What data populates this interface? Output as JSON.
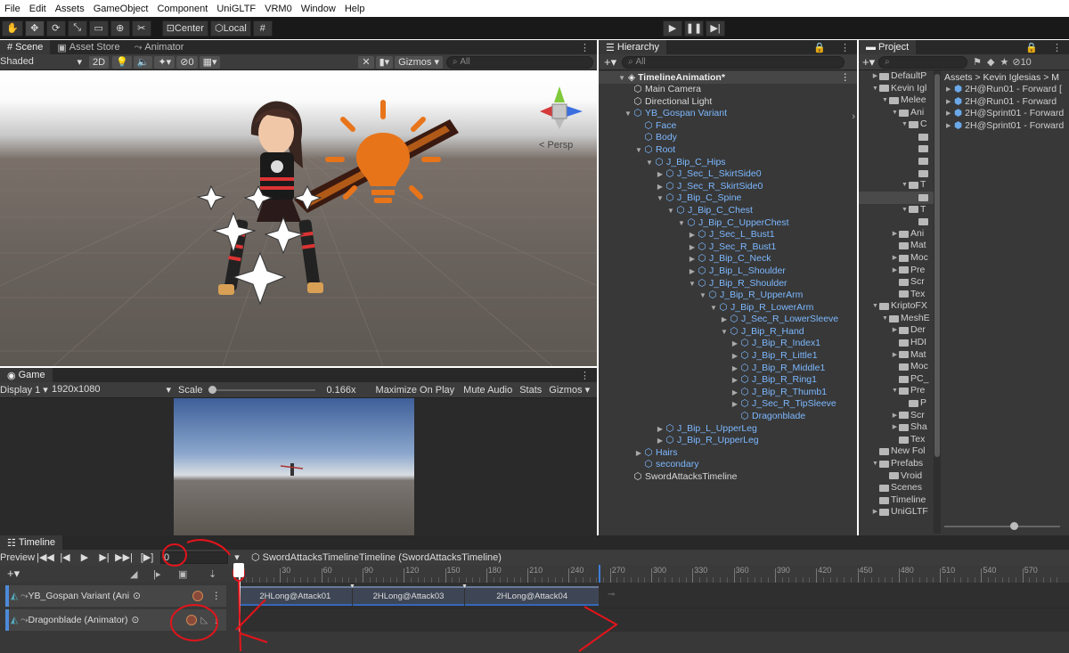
{
  "menu": [
    "File",
    "Edit",
    "Assets",
    "GameObject",
    "Component",
    "UniGLTF",
    "VRM0",
    "Window",
    "Help"
  ],
  "toolbar": {
    "center": "Center",
    "local": "Local"
  },
  "scene": {
    "tabs": [
      "Scene",
      "Asset Store",
      "Animator"
    ],
    "shading": "Shaded",
    "mode2d": "2D",
    "gizmo_count": "0",
    "gizmos": "Gizmos",
    "search_placeholder": "All",
    "persp": "Persp"
  },
  "game": {
    "tab": "Game",
    "display": "Display 1",
    "resolution": "1920x1080",
    "scale_label": "Scale",
    "scale_value": "0.166x",
    "buttons": [
      "Maximize On Play",
      "Mute Audio",
      "Stats",
      "Gizmos"
    ]
  },
  "hierarchy": {
    "tab": "Hierarchy",
    "search_placeholder": "All",
    "scene_name": "TimelineAnimation*",
    "rows": [
      {
        "t": "Main Camera",
        "d": 1,
        "c": "white",
        "a": ""
      },
      {
        "t": "Directional Light",
        "d": 1,
        "c": "white",
        "a": ""
      },
      {
        "t": "YB_Gospan Variant",
        "d": 1,
        "c": "blue",
        "a": "▼"
      },
      {
        "t": "Face",
        "d": 2,
        "c": "blue",
        "a": ""
      },
      {
        "t": "Body",
        "d": 2,
        "c": "blue",
        "a": ""
      },
      {
        "t": "Root",
        "d": 2,
        "c": "blue",
        "a": "▼"
      },
      {
        "t": "J_Bip_C_Hips",
        "d": 3,
        "c": "blue",
        "a": "▼"
      },
      {
        "t": "J_Sec_L_SkirtSide0",
        "d": 4,
        "c": "blue",
        "a": "▶"
      },
      {
        "t": "J_Sec_R_SkirtSide0",
        "d": 4,
        "c": "blue",
        "a": "▶"
      },
      {
        "t": "J_Bip_C_Spine",
        "d": 4,
        "c": "blue",
        "a": "▼"
      },
      {
        "t": "J_Bip_C_Chest",
        "d": 5,
        "c": "blue",
        "a": "▼"
      },
      {
        "t": "J_Bip_C_UpperChest",
        "d": 6,
        "c": "blue",
        "a": "▼"
      },
      {
        "t": "J_Sec_L_Bust1",
        "d": 7,
        "c": "blue",
        "a": "▶"
      },
      {
        "t": "J_Sec_R_Bust1",
        "d": 7,
        "c": "blue",
        "a": "▶"
      },
      {
        "t": "J_Bip_C_Neck",
        "d": 7,
        "c": "blue",
        "a": "▶"
      },
      {
        "t": "J_Bip_L_Shoulder",
        "d": 7,
        "c": "blue",
        "a": "▶"
      },
      {
        "t": "J_Bip_R_Shoulder",
        "d": 7,
        "c": "blue",
        "a": "▼"
      },
      {
        "t": "J_Bip_R_UpperArm",
        "d": 8,
        "c": "blue",
        "a": "▼"
      },
      {
        "t": "J_Bip_R_LowerArm",
        "d": 9,
        "c": "blue",
        "a": "▼"
      },
      {
        "t": "J_Sec_R_LowerSleeve",
        "d": 10,
        "c": "blue",
        "a": "▶"
      },
      {
        "t": "J_Bip_R_Hand",
        "d": 10,
        "c": "blue",
        "a": "▼"
      },
      {
        "t": "J_Bip_R_Index1",
        "d": 11,
        "c": "blue",
        "a": "▶"
      },
      {
        "t": "J_Bip_R_Little1",
        "d": 11,
        "c": "blue",
        "a": "▶"
      },
      {
        "t": "J_Bip_R_Middle1",
        "d": 11,
        "c": "blue",
        "a": "▶"
      },
      {
        "t": "J_Bip_R_Ring1",
        "d": 11,
        "c": "blue",
        "a": "▶"
      },
      {
        "t": "J_Bip_R_Thumb1",
        "d": 11,
        "c": "blue",
        "a": "▶"
      },
      {
        "t": "J_Sec_R_TipSleeve",
        "d": 11,
        "c": "blue",
        "a": "▶"
      },
      {
        "t": "Dragonblade",
        "d": 11,
        "c": "blue",
        "a": ""
      },
      {
        "t": "J_Bip_L_UpperLeg",
        "d": 4,
        "c": "blue",
        "a": "▶"
      },
      {
        "t": "J_Bip_R_UpperLeg",
        "d": 4,
        "c": "blue",
        "a": "▶"
      },
      {
        "t": "Hairs",
        "d": 2,
        "c": "blue",
        "a": "▶"
      },
      {
        "t": "secondary",
        "d": 2,
        "c": "blue",
        "a": ""
      },
      {
        "t": "SwordAttacksTimeline",
        "d": 1,
        "c": "white",
        "a": ""
      }
    ]
  },
  "project": {
    "tab": "Project",
    "count": "10",
    "breadcrumb": [
      "Assets",
      "Kevin Iglesias",
      "M"
    ],
    "tree": [
      {
        "t": "DefaultP",
        "d": 0,
        "a": "▶"
      },
      {
        "t": "Kevin Igl",
        "d": 0,
        "a": "▼"
      },
      {
        "t": "Melee",
        "d": 1,
        "a": "▼"
      },
      {
        "t": "Ani",
        "d": 2,
        "a": "▼"
      },
      {
        "t": "C",
        "d": 3,
        "a": "▼"
      },
      {
        "t": "",
        "d": 4,
        "a": ""
      },
      {
        "t": "",
        "d": 4,
        "a": ""
      },
      {
        "t": "",
        "d": 4,
        "a": ""
      },
      {
        "t": "",
        "d": 4,
        "a": ""
      },
      {
        "t": "T",
        "d": 3,
        "a": "▼"
      },
      {
        "t": "",
        "d": 4,
        "a": "",
        "sel": true
      },
      {
        "t": "T",
        "d": 3,
        "a": "▼"
      },
      {
        "t": "",
        "d": 4,
        "a": ""
      },
      {
        "t": "Ani",
        "d": 2,
        "a": "▶"
      },
      {
        "t": "Mat",
        "d": 2,
        "a": ""
      },
      {
        "t": "Moc",
        "d": 2,
        "a": "▶"
      },
      {
        "t": "Pre",
        "d": 2,
        "a": "▶"
      },
      {
        "t": "Scr",
        "d": 2,
        "a": ""
      },
      {
        "t": "Tex",
        "d": 2,
        "a": ""
      },
      {
        "t": "KriptoFX",
        "d": 0,
        "a": "▼"
      },
      {
        "t": "MeshE",
        "d": 1,
        "a": "▼"
      },
      {
        "t": "Der",
        "d": 2,
        "a": "▶"
      },
      {
        "t": "HDI",
        "d": 2,
        "a": ""
      },
      {
        "t": "Mat",
        "d": 2,
        "a": "▶"
      },
      {
        "t": "Moc",
        "d": 2,
        "a": ""
      },
      {
        "t": "PC_",
        "d": 2,
        "a": ""
      },
      {
        "t": "Pre",
        "d": 2,
        "a": "▼"
      },
      {
        "t": "P",
        "d": 3,
        "a": ""
      },
      {
        "t": "Scr",
        "d": 2,
        "a": "▶"
      },
      {
        "t": "Sha",
        "d": 2,
        "a": "▶"
      },
      {
        "t": "Tex",
        "d": 2,
        "a": ""
      },
      {
        "t": "New Fol",
        "d": 0,
        "a": ""
      },
      {
        "t": "Prefabs",
        "d": 0,
        "a": "▼"
      },
      {
        "t": "Vroid",
        "d": 1,
        "a": ""
      },
      {
        "t": "Scenes",
        "d": 0,
        "a": ""
      },
      {
        "t": "Timeline",
        "d": 0,
        "a": ""
      },
      {
        "t": "UniGLTF",
        "d": 0,
        "a": "▶"
      }
    ],
    "assets": [
      "2H@Run01 - Forward [",
      "2H@Run01 - Forward",
      "2H@Sprint01 - Forward",
      "2H@Sprint01 - Forward"
    ]
  },
  "timeline": {
    "tab": "Timeline",
    "preview": "Preview",
    "frame": "0",
    "asset": "SwordAttacksTimelineTimeline (SwordAttacksTimeline)",
    "ticks": [
      "0",
      "30",
      "60",
      "90",
      "120",
      "150",
      "180",
      "210",
      "240",
      "270",
      "300",
      "330",
      "360",
      "390",
      "420",
      "450",
      "480",
      "510",
      "540",
      "570"
    ],
    "tracks": [
      {
        "name": "YB_Gospan Variant (Ani"
      },
      {
        "name": "Dragonblade (Animator)"
      }
    ],
    "clips": [
      "2HLong@Attack01",
      "2HLong@Attack03",
      "2HLong@Attack04"
    ]
  },
  "colors": {
    "accent": "#3d7fd6",
    "annotation": "#e3141b",
    "blade": "#e8741a"
  }
}
